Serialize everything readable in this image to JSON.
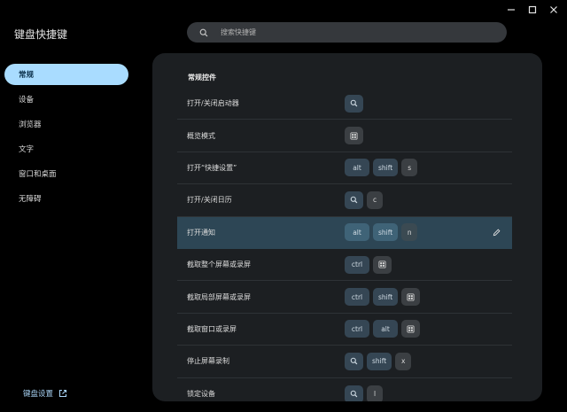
{
  "app": {
    "title": "键盘快捷键"
  },
  "search": {
    "placeholder": "搜索快捷键"
  },
  "sidebar": {
    "items": [
      {
        "label": "常规",
        "active": true
      },
      {
        "label": "设备",
        "active": false
      },
      {
        "label": "浏览器",
        "active": false
      },
      {
        "label": "文字",
        "active": false
      },
      {
        "label": "窗口和桌面",
        "active": false
      },
      {
        "label": "无障碍",
        "active": false
      }
    ],
    "footer_link": "键盘设置"
  },
  "main": {
    "section_title": "常规控件",
    "rows": [
      {
        "label": "打开/关闭启动器",
        "keys": [
          {
            "type": "icon",
            "icon": "search-icon"
          }
        ]
      },
      {
        "label": "概览模式",
        "keys": [
          {
            "type": "icon",
            "icon": "overview-icon",
            "plain": true
          }
        ]
      },
      {
        "label": "打开“快捷设置”",
        "keys": [
          {
            "type": "text",
            "text": "alt"
          },
          {
            "type": "text",
            "text": "shift"
          },
          {
            "type": "text",
            "text": "s",
            "plain": true
          }
        ]
      },
      {
        "label": "打开/关闭日历",
        "keys": [
          {
            "type": "icon",
            "icon": "search-icon"
          },
          {
            "type": "text",
            "text": "c",
            "plain": true
          }
        ]
      },
      {
        "label": "打开通知",
        "keys": [
          {
            "type": "text",
            "text": "alt"
          },
          {
            "type": "text",
            "text": "shift"
          },
          {
            "type": "text",
            "text": "n",
            "plain": true
          }
        ],
        "highlighted": true
      },
      {
        "label": "截取整个屏幕或录屏",
        "keys": [
          {
            "type": "text",
            "text": "ctrl"
          },
          {
            "type": "icon",
            "icon": "overview-icon",
            "plain": true
          }
        ]
      },
      {
        "label": "截取局部屏幕或录屏",
        "keys": [
          {
            "type": "text",
            "text": "ctrl"
          },
          {
            "type": "text",
            "text": "shift"
          },
          {
            "type": "icon",
            "icon": "overview-icon",
            "plain": true
          }
        ]
      },
      {
        "label": "截取窗口或录屏",
        "keys": [
          {
            "type": "text",
            "text": "ctrl"
          },
          {
            "type": "text",
            "text": "alt"
          },
          {
            "type": "icon",
            "icon": "overview-icon",
            "plain": true
          }
        ]
      },
      {
        "label": "停止屏幕录制",
        "keys": [
          {
            "type": "icon",
            "icon": "search-icon"
          },
          {
            "type": "text",
            "text": "shift"
          },
          {
            "type": "text",
            "text": "x",
            "plain": true
          }
        ]
      },
      {
        "label": "锁定设备",
        "keys": [
          {
            "type": "icon",
            "icon": "search-icon"
          },
          {
            "type": "text",
            "text": "l",
            "plain": true
          }
        ]
      }
    ]
  },
  "colors": {
    "background": "#000000",
    "panel": "#1c1f22",
    "active_nav": "#a9dcff",
    "key": "#354654",
    "highlight_row": "#2d4655",
    "link": "#a8d3f5"
  }
}
